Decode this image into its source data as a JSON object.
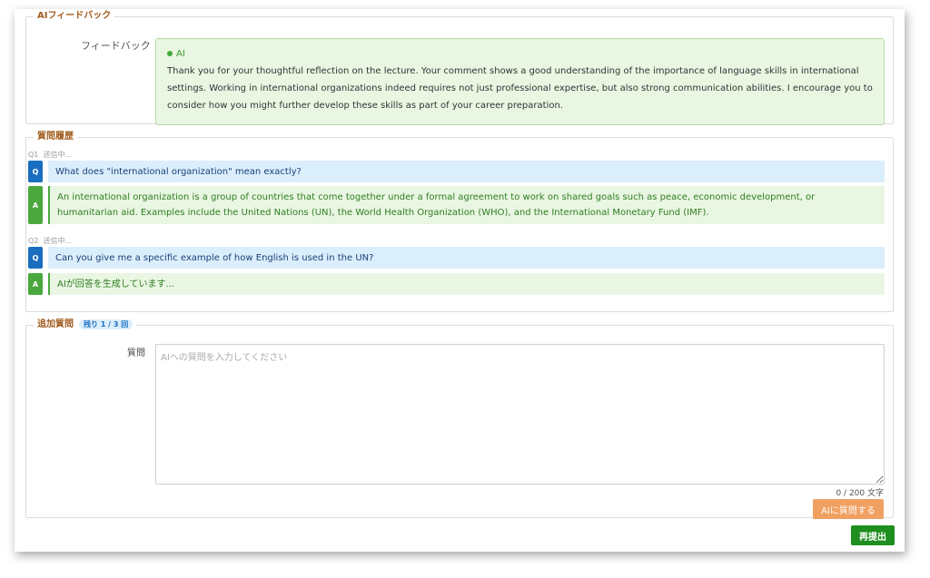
{
  "feedback": {
    "legend": "AIフィードバック",
    "label": "フィードバック",
    "ai_tag": "AI",
    "text": "Thank you for your thoughtful reflection on the lecture. Your comment shows a good understanding of the importance of language skills in international settings. Working in international organizations indeed requires not just professional expertise, but also strong communication abilities. I encourage you to consider how you might further develop these skills as part of your career preparation."
  },
  "history": {
    "legend": "質問履歴",
    "items": [
      {
        "num": "Q1",
        "status": "送信中...",
        "q_badge": "Q",
        "question": "What does \"international organization\" mean exactly?",
        "a_badge": "A",
        "answer": "An international organization is a group of countries that come together under a formal agreement to work on shared goals such as peace, economic development, or humanitarian aid. Examples include the United Nations (UN), the World Health Organization (WHO), and the International Monetary Fund (IMF)."
      },
      {
        "num": "Q2",
        "status": "送信中...",
        "q_badge": "Q",
        "question": "Can you give me a specific example of how English is used in the UN?",
        "a_badge": "A",
        "answer": "AIが回答を生成しています..."
      }
    ]
  },
  "additional": {
    "legend": "追加質問",
    "remaining": "残り 1 / 3 回",
    "label": "質問",
    "placeholder": "AIへの質問を入力してください",
    "value": "",
    "char_count": "0 / 200 文字",
    "ask_button": "AIに質問する"
  },
  "resubmit_button": "再提出",
  "colors": {
    "legend": "#a05a1c",
    "question_badge": "#1a6ec0",
    "answer_badge": "#4aa83c",
    "ask_button": "#f0a061",
    "resubmit_button": "#1e8f1e"
  }
}
